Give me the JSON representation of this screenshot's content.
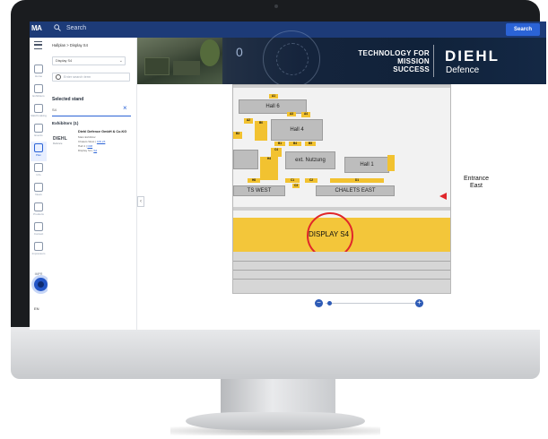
{
  "topbar": {
    "logo": "MA",
    "search_placeholder": "Search",
    "search_button": "Search"
  },
  "rail": {
    "items": [
      {
        "label": "Home",
        "icon": "home-icon"
      },
      {
        "label": "Exhibitors",
        "icon": "grid-icon"
      },
      {
        "label": "Matchmaking",
        "icon": "network-icon"
      },
      {
        "label": "Events",
        "icon": "calendar-icon"
      },
      {
        "label": "Plan",
        "icon": "map-icon"
      },
      {
        "label": "Info",
        "icon": "person-icon"
      },
      {
        "label": "News",
        "icon": "document-icon"
      },
      {
        "label": "Products",
        "icon": "box-icon"
      },
      {
        "label": "Contact",
        "icon": "phone-icon"
      },
      {
        "label": "Impressum",
        "icon": "info-icon"
      }
    ],
    "footer_label": "IMPR",
    "footer_label2": "DA7",
    "language": "EN"
  },
  "panel": {
    "breadcrumb": "Hallplan > Display S4",
    "select_value": "Display S4",
    "search_placeholder": "Enter search term",
    "selected_title": "Selected stand",
    "selected_value": "S4",
    "exhibitors_title": "Exhibitors (1)",
    "exhibitor": {
      "logo": "DIEHL",
      "logo_sub": "Defence",
      "name": "Diehl Defence GmbH & Co.KG",
      "line1": "Main Exhibitor",
      "line2": "Chalets West |",
      "line2_link": "CW 23",
      "line3": "Hall 4 |",
      "line3_link": "C08",
      "line4": "Display S4 |",
      "line4_link": "S4"
    }
  },
  "banner": {
    "counter": "0",
    "tagline_1": "TECHNOLOGY FOR",
    "tagline_2": "MISSION",
    "tagline_3": "SUCCESS",
    "brand": "DIEHL",
    "brand_sub": "Defence"
  },
  "map": {
    "halls": {
      "hall6": "Hall 6",
      "hall4": "Hall 4",
      "ext": "ext. Nutzung",
      "hall1": "Hall 1",
      "chalets_east": "CHALETS EAST",
      "chalets_west": "TS WEST",
      "display": "DISPLAY S4"
    },
    "stands": {
      "a1": "A1",
      "a3": "A3",
      "a4": "A4",
      "a2": "A2",
      "b0": "B0",
      "b3": "B3",
      "c4": "C4",
      "h4": "H4",
      "b1": "B1",
      "b4": "B4",
      "b5": "B5",
      "c1": "C1",
      "c2": "C2",
      "c3": "C3",
      "d1": "D1",
      "b8": "H8",
      "cw": "E3"
    },
    "entrance_1": "Entrance",
    "entrance_2": "East"
  },
  "zoom": {
    "minus": "−",
    "plus": "+",
    "level": 0.04
  },
  "colors": {
    "topbar": "#1d3b78",
    "accent": "#2b63d6",
    "stand_yellow": "#f2c230",
    "highlight_red": "#e0262b"
  }
}
